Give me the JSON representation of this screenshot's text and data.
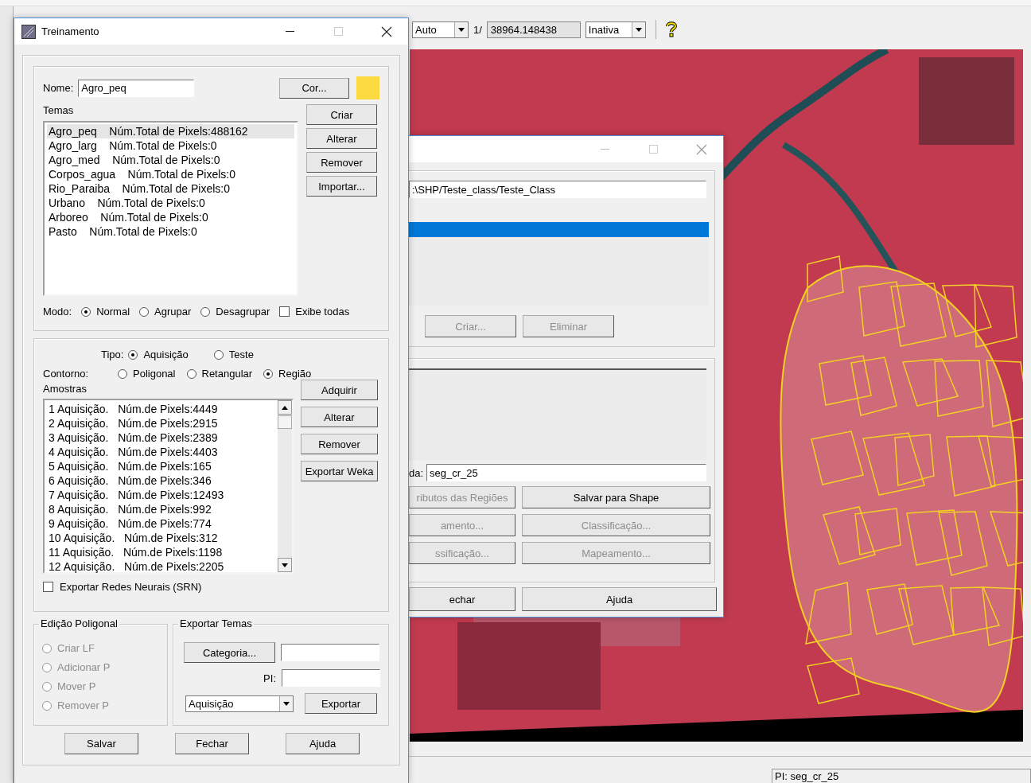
{
  "toolbar": {
    "zoom_select": "Auto",
    "page_label": "1/",
    "scale_value": "38964.148438",
    "mode_select": "Inativa"
  },
  "classification_dialog": {
    "path_value": ":\\SHP/Teste_class/Teste_Class",
    "layers": [
      {
        "selected": true
      }
    ],
    "top_buttons": [
      {
        "label": "Criar...",
        "disabled": true
      },
      {
        "label": "Eliminar",
        "disabled": true
      }
    ],
    "output_label": "da:",
    "output_value": "seg_cr_25",
    "grid_buttons": [
      {
        "label": "ributos das Regiões",
        "disabled": true
      },
      {
        "label": "Salvar para Shape",
        "disabled": false
      },
      {
        "label": "amento...",
        "disabled": true
      },
      {
        "label": "Classificação...",
        "disabled": true
      },
      {
        "label": "ssificação...",
        "disabled": true
      },
      {
        "label": "Mapeamento...",
        "disabled": true
      }
    ],
    "footer_buttons": [
      {
        "label": "echar",
        "disabled": false
      },
      {
        "label": "Ajuda",
        "disabled": false
      }
    ]
  },
  "training_dialog": {
    "title": "Treinamento",
    "name_label": "Nome:",
    "name_value": "Agro_peq",
    "color_button": "Cor...",
    "color": "#fcd93f",
    "themes_label": "Temas",
    "themes": [
      {
        "text": "Agro_peq    Núm.Total de Pixels:488162",
        "selected": true
      },
      {
        "text": "Agro_larg    Núm.Total de Pixels:0",
        "selected": false
      },
      {
        "text": "Agro_med    Núm.Total de Pixels:0",
        "selected": false
      },
      {
        "text": "Corpos_agua    Núm.Total de Pixels:0",
        "selected": false
      },
      {
        "text": "Rio_Paraiba    Núm.Total de Pixels:0",
        "selected": false
      },
      {
        "text": "Urbano    Núm.Total de Pixels:0",
        "selected": false
      },
      {
        "text": "Arboreo    Núm.Total de Pixels:0",
        "selected": false
      },
      {
        "text": "Pasto    Núm.Total de Pixels:0",
        "selected": false
      }
    ],
    "theme_buttons": [
      "Criar",
      "Alterar",
      "Remover",
      "Importar..."
    ],
    "mode_label": "Modo:",
    "modes": [
      {
        "label": "Normal",
        "selected": true
      },
      {
        "label": "Agrupar",
        "selected": false
      },
      {
        "label": "Desagrupar",
        "selected": false
      }
    ],
    "show_all": {
      "label": "Exibe todas",
      "checked": false
    },
    "type_label": "Tipo:",
    "types": [
      {
        "label": "Aquisição",
        "selected": true
      },
      {
        "label": "Teste",
        "selected": false
      }
    ],
    "contour_label": "Contorno:",
    "contours": [
      {
        "label": "Poligonal",
        "selected": false
      },
      {
        "label": "Retangular",
        "selected": false
      },
      {
        "label": "Região",
        "selected": true
      }
    ],
    "samples_label": "Amostras",
    "samples": [
      "1 Aquisição.   Núm.de Pixels:4449",
      "2 Aquisição.   Núm.de Pixels:2915",
      "3 Aquisição.   Núm.de Pixels:2389",
      "4 Aquisição.   Núm.de Pixels:4403",
      "5 Aquisição.   Núm.de Pixels:165",
      "6 Aquisição.   Núm.de Pixels:346",
      "7 Aquisição.   Núm.de Pixels:12493",
      "8 Aquisição.   Núm.de Pixels:992",
      "9 Aquisição.   Núm.de Pixels:774",
      "10 Aquisição.   Núm.de Pixels:312",
      "11 Aquisição.   Núm.de Pixels:1198",
      "12 Aquisição.   Núm.de Pixels:2205"
    ],
    "sample_buttons": [
      "Adquirir",
      "Alterar",
      "Remover",
      "Exportar Weka"
    ],
    "export_srn": {
      "label": "Exportar Redes Neurais (SRN)",
      "checked": false
    },
    "polygon_edit": {
      "title": "Edição Poligonal",
      "options": [
        {
          "label": "Criar LF",
          "selected": false,
          "disabled": true
        },
        {
          "label": "Adicionar P",
          "selected": false,
          "disabled": true
        },
        {
          "label": "Mover P",
          "selected": false,
          "disabled": true
        },
        {
          "label": "Remover P",
          "selected": false,
          "disabled": true
        }
      ]
    },
    "export_themes": {
      "title": "Exportar Temas",
      "category_button": "Categoria...",
      "pi_label": "PI:",
      "type_select": "Aquisição",
      "export_button": "Exportar"
    },
    "footer_buttons": [
      "Salvar",
      "Fechar",
      "Ajuda"
    ]
  },
  "status_bar": {
    "plane_info": "PI: seg_cr_25"
  }
}
